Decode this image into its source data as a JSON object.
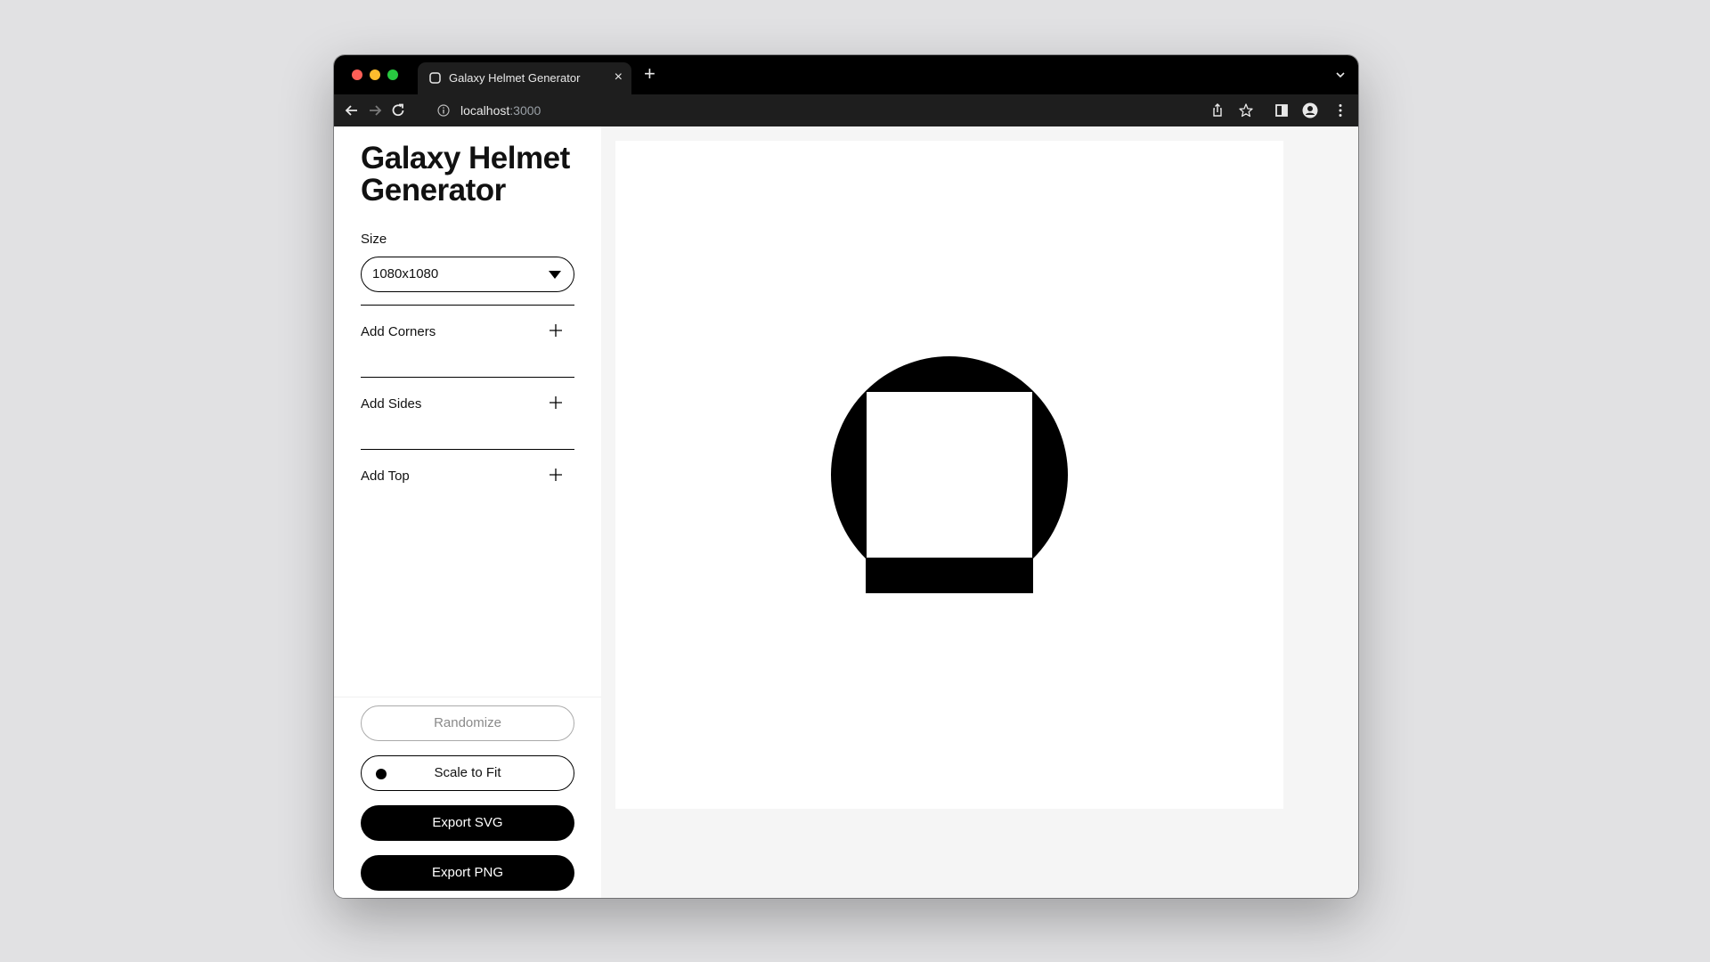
{
  "browser": {
    "tab_title": "Galaxy Helmet Generator",
    "tab_close": "×",
    "new_tab": "+",
    "url_host": "localhost",
    "url_port": ":3000"
  },
  "app": {
    "title": "Galaxy Helmet Generator",
    "size": {
      "label": "Size",
      "selected": "1080x1080"
    },
    "options": [
      {
        "label": "Add Corners",
        "icon": "plus-icon"
      },
      {
        "label": "Add Sides",
        "icon": "plus-icon"
      },
      {
        "label": "Add Top",
        "icon": "plus-icon"
      }
    ],
    "buttons": {
      "randomize": "Randomize",
      "scale_to_fit": "Scale to Fit",
      "export_svg": "Export SVG",
      "export_png": "Export PNG"
    }
  },
  "colors": {
    "shape": "#000000",
    "canvas_background": "#ffffff",
    "workspace_background": "#f5f5f5"
  }
}
